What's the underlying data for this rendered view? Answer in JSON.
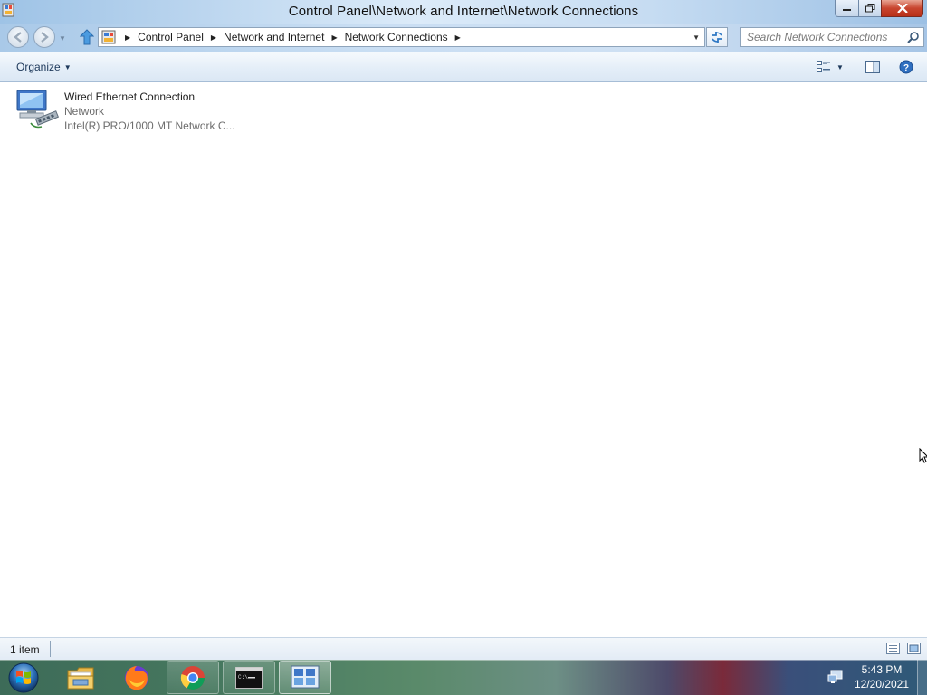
{
  "window": {
    "title": "Control Panel\\Network and Internet\\Network Connections",
    "minimize_icon": "minimize-icon",
    "maximize_icon": "restore-icon",
    "close_icon": "close-icon"
  },
  "address": {
    "breadcrumbs": [
      "Control Panel",
      "Network and Internet",
      "Network Connections"
    ],
    "search_placeholder": "Search Network Connections"
  },
  "toolbar": {
    "organize_label": "Organize"
  },
  "connections": [
    {
      "name": "Wired Ethernet Connection",
      "status": "Network",
      "device": "Intel(R) PRO/1000 MT Network C..."
    }
  ],
  "statusbar": {
    "item_count": "1 item"
  },
  "taskbar": {
    "apps": [
      "windows-explorer",
      "firefox",
      "chrome",
      "command-prompt",
      "network-connections"
    ],
    "clock_time": "5:43 PM",
    "clock_date": "12/20/2021"
  },
  "colors": {
    "accent": "#1e395b",
    "title_bar": "#b9d4ee",
    "close_button": "#c8452f"
  }
}
